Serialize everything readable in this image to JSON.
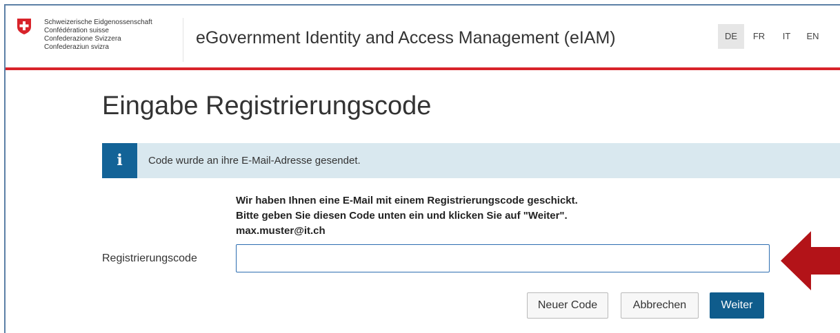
{
  "header": {
    "coat_of_arms_icon": "swiss-cross-icon",
    "federal_names": [
      "Schweizerische Eidgenossenschaft",
      "Confédération suisse",
      "Confederazione Svizzera",
      "Confederaziun svizra"
    ],
    "app_title": "eGovernment Identity and Access Management (eIAM)",
    "languages": [
      {
        "code": "DE",
        "active": true
      },
      {
        "code": "FR",
        "active": false
      },
      {
        "code": "IT",
        "active": false
      },
      {
        "code": "EN",
        "active": false
      }
    ]
  },
  "main": {
    "page_title": "Eingabe Registrierungscode",
    "alert": {
      "icon": "info-icon",
      "icon_glyph": "i",
      "text": "Code wurde an ihre E-Mail-Adresse gesendet."
    },
    "instructions": [
      "Wir haben Ihnen eine E-Mail mit einem Registrierungscode geschickt.",
      "Bitte geben Sie diesen Code unten ein und klicken Sie auf \"Weiter\".",
      "max.muster@it.ch"
    ],
    "code_field": {
      "label": "Registrierungscode",
      "value": "",
      "placeholder": ""
    },
    "buttons": {
      "new_code": "Neuer Code",
      "cancel": "Abbrechen",
      "next": "Weiter"
    },
    "annotation_arrow_icon": "red-arrow-left-icon"
  },
  "colors": {
    "brand_red": "#d8232a",
    "primary_blue": "#0f5c8c",
    "info_blue": "#136397",
    "alert_bg": "#d9e8ef",
    "arrow_red": "#b31318"
  }
}
